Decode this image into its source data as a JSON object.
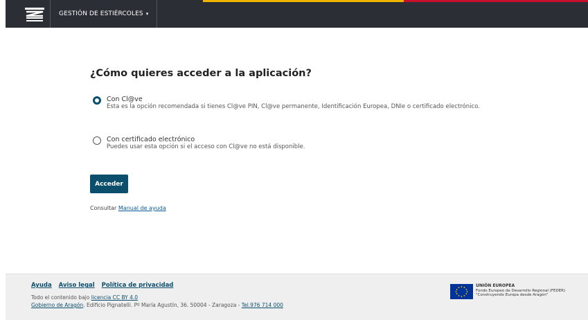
{
  "header": {
    "app_menu_label": "GESTIÓN DE ESTIÉRCOLES",
    "logo_icon": "aragon-logo-icon",
    "colors": {
      "bar": "#2b2e34",
      "stripe_yellow": "#f0b400",
      "stripe_red": "#c8102e"
    }
  },
  "main": {
    "title": "¿Cómo quieres acceder a la aplicación?",
    "options": [
      {
        "title": "Con Cl@ve",
        "description": "Esta es la opción recomendada si tienes Cl@ve PIN, Cl@ve permanente, Identificación Europea, DNIe o certificado electrónico.",
        "selected": true
      },
      {
        "title": "Con certificado electrónico",
        "description": "Puedes usar esta opción si el acceso con Cl@ve no está disponible.",
        "selected": false
      }
    ],
    "submit_label": "Acceder",
    "help_prefix": "Consultar",
    "help_link": "Manual de ayuda",
    "accent": "#0b4f6c"
  },
  "footer": {
    "links": [
      "Ayuda",
      "Aviso legal",
      "Política de privacidad"
    ],
    "license_prefix": "Todo el contenido bajo",
    "license_link": "licencia CC BY 4.0",
    "gov_link": "Gobierno de Aragón",
    "address": ". Edificio Pignatelli. Pº María Agustín, 36. 50004 - Zaragoza -",
    "phone_link": "Tel.976 714 000",
    "eu": {
      "title": "UNIÓN EUROPEA",
      "line1": "Fondo Europeo de Desarrollo Regional (FEDER)",
      "line2": "\"Construyendo Europa desde Aragón\""
    }
  }
}
